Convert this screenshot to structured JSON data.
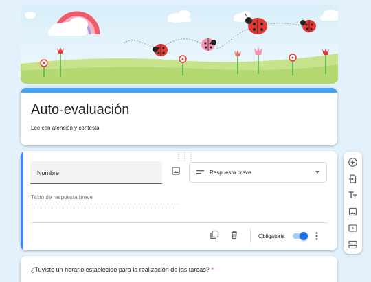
{
  "form": {
    "title": "Auto-evaluación",
    "description": "Lee con atención y contesta"
  },
  "question1": {
    "title_value": "Nombre",
    "type_selected": "Respuesta breve",
    "answer_placeholder": "Texto de respuesta breve",
    "required_label": "Obligatoria",
    "required": true
  },
  "question2": {
    "title": "¿Tuviste un horario establecido para la realización de las tareas?",
    "required_mark": "*"
  },
  "colors": {
    "accent": "#42a5f5",
    "active_border": "#4285f4",
    "toggle_on": "#1a73e8",
    "required_star": "#d93025"
  },
  "icons": {
    "toolbar": [
      "add-circle-icon",
      "import-questions-icon",
      "title-text-icon",
      "image-icon",
      "video-icon",
      "section-icon"
    ],
    "footer": [
      "duplicate-icon",
      "delete-icon",
      "more-vert-icon"
    ]
  }
}
